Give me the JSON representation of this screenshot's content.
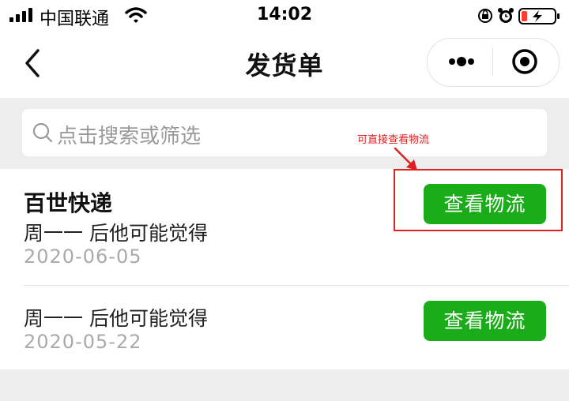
{
  "status_bar": {
    "carrier": "中国联通",
    "time": "14:02"
  },
  "nav": {
    "title": "发货单"
  },
  "search": {
    "placeholder": "点击搜索或筛选"
  },
  "annotation": {
    "text": "可直接查看物流",
    "color": "#e02020"
  },
  "orders": [
    {
      "company": "百世快递",
      "desc": "周一一 后他可能觉得",
      "date": "2020-06-05",
      "button": "查看物流"
    },
    {
      "desc": "周一一 后他可能觉得",
      "date": "2020-05-22",
      "button": "查看物流"
    }
  ],
  "colors": {
    "accent": "#1aad19",
    "annotation": "#e02020",
    "background": "#ededed"
  }
}
